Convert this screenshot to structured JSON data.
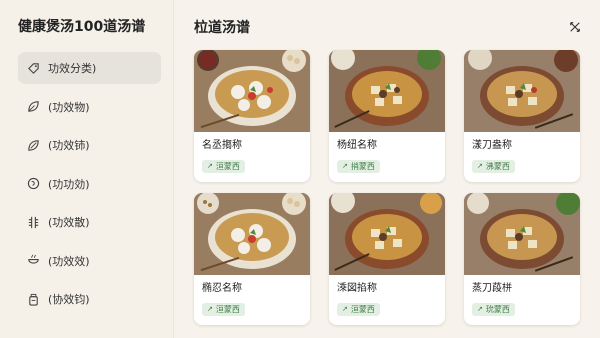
{
  "app": {
    "title": "健康煲汤100道汤谱"
  },
  "sidebar": {
    "items": [
      {
        "label": "功效分类)",
        "icon": "tag-icon",
        "active": true
      },
      {
        "label": "(功效物)",
        "icon": "leaf-icon",
        "active": false
      },
      {
        "label": "(功效铈)",
        "icon": "leaf-icon",
        "active": false
      },
      {
        "label": "(功功効)",
        "icon": "swirl-icon",
        "active": false
      },
      {
        "label": "(功效散)",
        "icon": "chinese-char-icon",
        "active": false
      },
      {
        "label": "(功效效)",
        "icon": "pot-icon",
        "active": false
      },
      {
        "label": "(协效钧)",
        "icon": "jar-icon",
        "active": false
      }
    ]
  },
  "header": {
    "title": "柆道汤谱",
    "close_icon": "close-icon"
  },
  "cards": [
    {
      "name": "名丞搊称",
      "tag": "洹蒙西",
      "variant": "bowl"
    },
    {
      "name": "杨纽名称",
      "tag": "捎蒙西",
      "variant": "clay"
    },
    {
      "name": "漾刀盎称",
      "tag": "沸蒙西",
      "variant": "clay2"
    },
    {
      "name": "椭忍名称",
      "tag": "洹蒙西",
      "variant": "bowl"
    },
    {
      "name": "溗図掐称",
      "tag": "洹蒙西",
      "variant": "clay"
    },
    {
      "name": "蒸刀葮栟",
      "tag": "玧蒙西",
      "variant": "clay2"
    }
  ],
  "colors": {
    "accent_green": "#3f7a46",
    "tag_bg": "#e3efe3",
    "sidebar_active": "#e6e3dc"
  }
}
